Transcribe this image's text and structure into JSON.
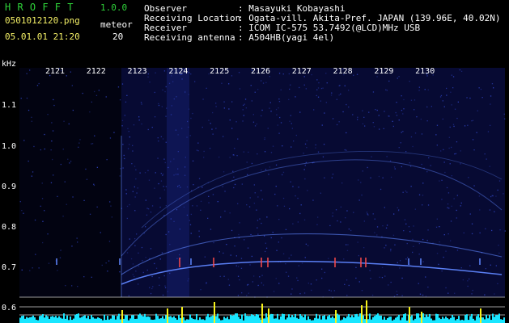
{
  "header": {
    "app_title": "H R O F F T",
    "version": "1.0.0",
    "file_name": "0501012120.png",
    "type_label": "meteor",
    "datetime": "05.01.01 21:20",
    "meteor_count": "20",
    "fields": [
      {
        "label": "Observer",
        "value": ": Masayuki Kobayashi"
      },
      {
        "label": "Receiving Location",
        "value": ": Ogata-vill. Akita-Pref. JAPAN (139.96E, 40.02N)"
      },
      {
        "label": "Receiver",
        "value": ": ICOM IC-575 53.7492(@LCD)MHz USB"
      },
      {
        "label": "Receiving antenna",
        "value": ": A504HB(yagi 4el)"
      }
    ]
  },
  "axes": {
    "y_unit": "kHz",
    "y_ticks": [
      "1.1",
      "1.0",
      "0.9",
      "0.8",
      "0.7",
      "0.6"
    ],
    "x_ticks": [
      "2121",
      "2122",
      "2123",
      "2124",
      "2125",
      "2126",
      "2127",
      "2128",
      "2129",
      "2130"
    ]
  },
  "colors": {
    "background": "#000000",
    "spectrum_bg": "#070a33",
    "noise": "#2c3fb5",
    "title_green": "#2fd33a",
    "label_yellow": "#f4f066",
    "trace_blue": "#5f86ff",
    "meteor_red": "#ff4a4a",
    "bar_cyan": "#19e6ff",
    "bar_yellow": "#f7f21a"
  }
}
